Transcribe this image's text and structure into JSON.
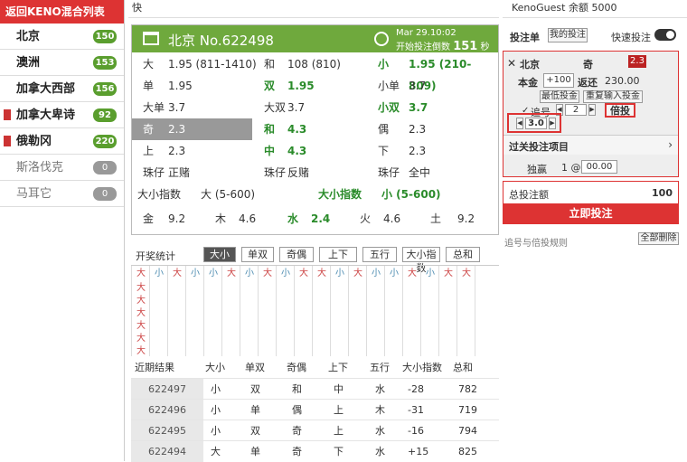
{
  "sidebar": {
    "header": "返回KENO混合列表",
    "items": [
      {
        "label": "北京",
        "count": "150",
        "flag": false,
        "active": true
      },
      {
        "label": "澳洲",
        "count": "153",
        "flag": false,
        "active": true
      },
      {
        "label": "加拿大西部",
        "count": "156",
        "flag": false,
        "active": true
      },
      {
        "label": "加拿大卑诗",
        "count": "92",
        "flag": true,
        "active": true
      },
      {
        "label": "俄勒冈",
        "count": "220",
        "flag": true,
        "active": true
      },
      {
        "label": "斯洛伐克",
        "count": "0",
        "flag": false,
        "active": false
      },
      {
        "label": "马耳它",
        "count": "0",
        "flag": false,
        "active": false
      }
    ]
  },
  "topbar": {
    "label": "快"
  },
  "board": {
    "title": "北京 No.622498",
    "date": "Mar 29.10:02",
    "countdown_label": "开始投注倒数",
    "countdown_value": "151",
    "countdown_unit": "秒",
    "rows": [
      [
        {
          "t": "大"
        },
        {
          "t": "1.95 (811-1410)"
        },
        {
          "t": "和"
        },
        {
          "t": "108  (810)"
        },
        {
          "t": "小",
          "g": true
        },
        {
          "t": "1.95 (210-809)",
          "g": true
        }
      ],
      [
        {
          "t": "单"
        },
        {
          "t": "1.95"
        },
        {
          "t": "双",
          "g": true
        },
        {
          "t": "1.95",
          "g": true
        },
        {
          "t": "小单"
        },
        {
          "t": "3.7"
        }
      ],
      [
        {
          "t": "大单"
        },
        {
          "t": "3.7"
        },
        {
          "t": "大双"
        },
        {
          "t": "3.7"
        },
        {
          "t": "小双",
          "g": true
        },
        {
          "t": "3.7",
          "g": true
        }
      ],
      [
        {
          "t": "奇"
        },
        {
          "t": "2.3"
        },
        {
          "t": "和",
          "g": true
        },
        {
          "t": "4.3",
          "g": true
        },
        {
          "t": "偶"
        },
        {
          "t": "2.3"
        }
      ],
      [
        {
          "t": "上"
        },
        {
          "t": "2.3"
        },
        {
          "t": "中",
          "g": true
        },
        {
          "t": "4.3",
          "g": true
        },
        {
          "t": "下"
        },
        {
          "t": "2.3"
        }
      ],
      [
        {
          "t": "珠仔"
        },
        {
          "t": "正赌"
        },
        {
          "t": "珠仔"
        },
        {
          "t": "反赌"
        },
        {
          "t": "珠仔"
        },
        {
          "t": "全中"
        }
      ]
    ],
    "index_row": [
      {
        "t": "大小指数"
      },
      {
        "t": "大 (5-600)"
      },
      {
        "t": "大小指数",
        "g": true
      },
      {
        "t": "小 (5-600)",
        "g": true
      }
    ],
    "element_row": [
      {
        "t": "金"
      },
      {
        "t": "9.2"
      },
      {
        "t": "木"
      },
      {
        "t": "4.6"
      },
      {
        "t": "水",
        "g": true
      },
      {
        "t": "2.4",
        "g": true
      },
      {
        "t": "火"
      },
      {
        "t": "4.6"
      },
      {
        "t": "土"
      },
      {
        "t": "9.2"
      }
    ]
  },
  "stats": {
    "label": "开奖统计",
    "tabs": [
      "大小",
      "单双",
      "奇偶",
      "上下",
      "五行",
      "大小指数",
      "总和"
    ],
    "grid_top": [
      "大",
      "小",
      "大",
      "小",
      "小",
      "大",
      "小",
      "大",
      "小",
      "大",
      "大",
      "小",
      "大",
      "小",
      "小",
      "大",
      "小",
      "大",
      "大"
    ],
    "grid_rows": [
      "大",
      "大",
      "大",
      "大",
      "大",
      "大"
    ]
  },
  "results": {
    "headers": [
      "近期结果",
      "大小",
      "单双",
      "奇偶",
      "上下",
      "五行",
      "大小指数",
      "总和"
    ],
    "rows": [
      [
        "622497",
        "小",
        "双",
        "和",
        "中",
        "水",
        "-28",
        "782"
      ],
      [
        "622496",
        "小",
        "单",
        "偶",
        "上",
        "木",
        "-31",
        "719"
      ],
      [
        "622495",
        "小",
        "双",
        "奇",
        "上",
        "水",
        "-16",
        "794"
      ],
      [
        "622494",
        "大",
        "单",
        "奇",
        "下",
        "水",
        "+15",
        "825"
      ]
    ]
  },
  "right": {
    "user": "KenoGuest 余额",
    "balance": "5000",
    "tab_bet": "投注单",
    "tab_mine": "我的投注",
    "quick_label": "快速投注",
    "ticket": {
      "game": "北京",
      "pick": "奇",
      "odds": "2.3",
      "stake_label": "本金",
      "stake": "+100",
      "return_label": "返还",
      "return": "230.00",
      "min_btn": "最低投金",
      "reenter_btn": "重复输入投金",
      "chase_label": "追号",
      "chase_value": "2",
      "multiply_btn": "倍投",
      "multiplier": "3.0"
    },
    "parlay_label": "过关投注项目",
    "single_label": "独赢",
    "single_count": "1 @",
    "single_value": "00.00",
    "total_label": "总投注额",
    "total_value": "100",
    "submit_label": "立即投注",
    "rules_label": "追号与倍投规则",
    "clear_label": "全部删除"
  },
  "colors": {
    "accent": "#dd3333",
    "green": "#6fa93d"
  }
}
